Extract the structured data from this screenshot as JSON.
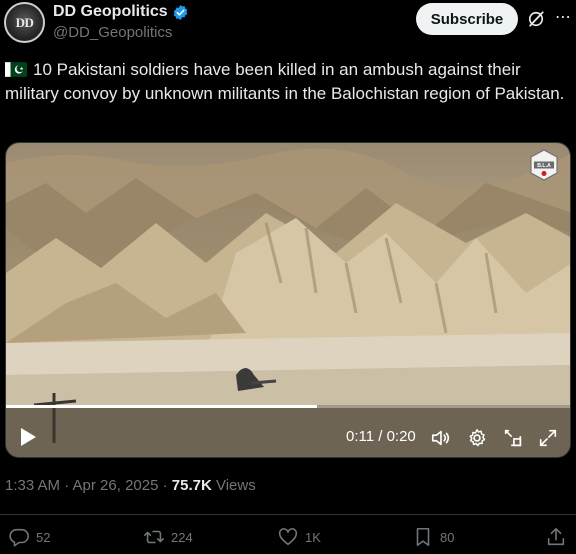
{
  "account": {
    "avatar_text": "DD",
    "name": "DD Geopolitics",
    "handle": "@DD_Geopolitics",
    "subscribe_label": "Subscribe"
  },
  "tweet": {
    "text": "10 Pakistani soldiers have been killed in an ambush against their military convoy by unknown militants in the Balochistan region of Pakistan."
  },
  "video": {
    "watermark_text": "B.L.A",
    "time": "0:11 / 0:20",
    "progress": 0.55
  },
  "meta": {
    "timestamp": "1:33 AM · Apr 26, 2025 · ",
    "views_count": "75.7K",
    "views_label": " Views"
  },
  "actions": {
    "replies": "52",
    "reposts": "224",
    "likes": "1K",
    "bookmarks": "80"
  },
  "colors": {
    "background": "#000000",
    "text": "#e7e9ea",
    "muted": "#71767b",
    "verified": "#1d9bf0"
  }
}
